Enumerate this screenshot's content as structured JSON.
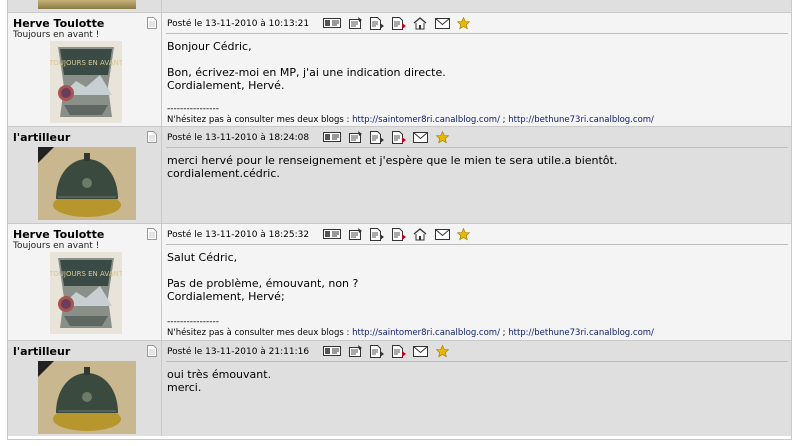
{
  "posts": [
    {
      "author": "Herve Toulotte",
      "rank": "Toujours en avant !",
      "posted": "Posté le 13-11-2010 à 10:13:21",
      "body": "Bonjour Cédric,\n\nBon, écrivez-moi en MP, j'ai une indication directe.\nCordialement, Hervé.",
      "sig_dashes": "----------------",
      "sig_text": "N'hésitez pas à consulter mes deux blogs : ",
      "sig_link1": "http://saintomer8ri.canalblog.com/",
      "sig_sep": " ; ",
      "sig_link2": "http://bethune73ri.canalblog.com/"
    },
    {
      "author": "l'artilleur",
      "posted": "Posté le 13-11-2010 à 18:24:08",
      "body": "merci hervé pour le renseignement et j'espère que le mien te sera utile.a bientôt.\ncordialement.cédric."
    },
    {
      "author": "Herve Toulotte",
      "rank": "Toujours en avant !",
      "posted": "Posté le 13-11-2010 à 18:25:32",
      "body": "Salut Cédric,\n\nPas de problème, émouvant, non ?\nCordialement, Hervé;",
      "sig_dashes": "----------------",
      "sig_text": "N'hésitez pas à consulter mes deux blogs : ",
      "sig_link1": "http://saintomer8ri.canalblog.com/",
      "sig_sep": " ; ",
      "sig_link2": "http://bethune73ri.canalblog.com/"
    },
    {
      "author": "l'artilleur",
      "posted": "Posté le 13-11-2010 à 21:11:16",
      "body": "oui très émouvant.\nmerci."
    }
  ],
  "icon_names": [
    "profile-card-icon",
    "send-pm-icon",
    "quote-icon",
    "quote-multi-icon",
    "homepage-icon",
    "email-icon",
    "star-icon"
  ],
  "colors": {
    "alt_row": "#dfdfdf",
    "norm_row": "#f4f4f4",
    "link": "#0a1d6b",
    "star": "#e8b800"
  }
}
